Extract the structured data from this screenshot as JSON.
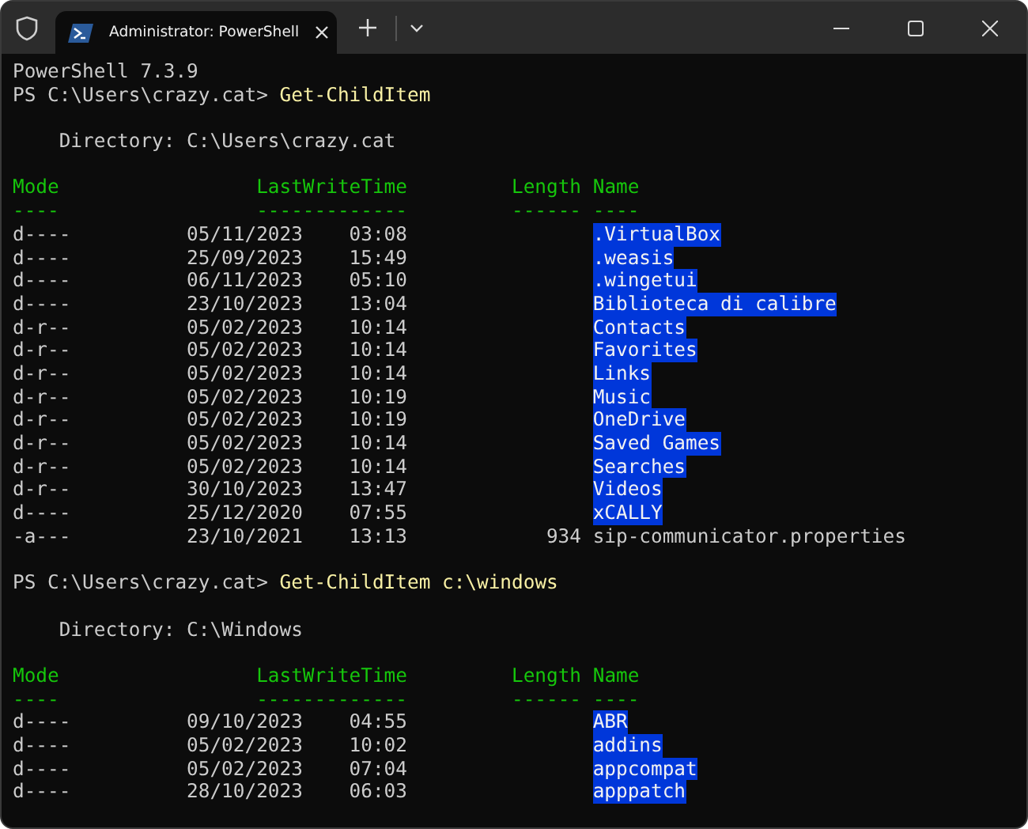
{
  "window": {
    "tab": {
      "title": "Administrator: PowerShell",
      "selected": true
    }
  },
  "console": {
    "banner": "PowerShell 7.3.9",
    "sessions": [
      {
        "prompt": "PS C:\\Users\\crazy.cat>",
        "command": "Get-ChildItem",
        "directory": "Directory: C:\\Users\\crazy.cat",
        "columns": [
          {
            "label": "Mode",
            "rule": "----"
          },
          {
            "label": "LastWriteTime",
            "rule": "-------------"
          },
          {
            "label": "Length",
            "rule": "------"
          },
          {
            "label": "Name",
            "rule": "----"
          }
        ],
        "rows": [
          {
            "mode": "d----",
            "date": "05/11/2023",
            "time": "03:08",
            "length": "",
            "name": ".VirtualBox",
            "kind": "directory"
          },
          {
            "mode": "d----",
            "date": "25/09/2023",
            "time": "15:49",
            "length": "",
            "name": ".weasis",
            "kind": "directory"
          },
          {
            "mode": "d----",
            "date": "06/11/2023",
            "time": "05:10",
            "length": "",
            "name": ".wingetui",
            "kind": "directory"
          },
          {
            "mode": "d----",
            "date": "23/10/2023",
            "time": "13:04",
            "length": "",
            "name": "Biblioteca di calibre",
            "kind": "directory"
          },
          {
            "mode": "d-r--",
            "date": "05/02/2023",
            "time": "10:14",
            "length": "",
            "name": "Contacts",
            "kind": "directory"
          },
          {
            "mode": "d-r--",
            "date": "05/02/2023",
            "time": "10:14",
            "length": "",
            "name": "Favorites",
            "kind": "directory"
          },
          {
            "mode": "d-r--",
            "date": "05/02/2023",
            "time": "10:14",
            "length": "",
            "name": "Links",
            "kind": "directory"
          },
          {
            "mode": "d-r--",
            "date": "05/02/2023",
            "time": "10:19",
            "length": "",
            "name": "Music",
            "kind": "directory"
          },
          {
            "mode": "d-r--",
            "date": "05/02/2023",
            "time": "10:19",
            "length": "",
            "name": "OneDrive",
            "kind": "directory"
          },
          {
            "mode": "d-r--",
            "date": "05/02/2023",
            "time": "10:14",
            "length": "",
            "name": "Saved Games",
            "kind": "directory"
          },
          {
            "mode": "d-r--",
            "date": "05/02/2023",
            "time": "10:14",
            "length": "",
            "name": "Searches",
            "kind": "directory"
          },
          {
            "mode": "d-r--",
            "date": "30/10/2023",
            "time": "13:47",
            "length": "",
            "name": "Videos",
            "kind": "directory"
          },
          {
            "mode": "d----",
            "date": "25/12/2020",
            "time": "07:55",
            "length": "",
            "name": "xCALLY",
            "kind": "directory"
          },
          {
            "mode": "-a---",
            "date": "23/10/2021",
            "time": "13:13",
            "length": "934",
            "name": "sip-communicator.properties",
            "kind": "file"
          }
        ]
      },
      {
        "prompt": "PS C:\\Users\\crazy.cat>",
        "command": "Get-ChildItem c:\\windows",
        "directory": "Directory: C:\\Windows",
        "columns": [
          {
            "label": "Mode",
            "rule": "----"
          },
          {
            "label": "LastWriteTime",
            "rule": "-------------"
          },
          {
            "label": "Length",
            "rule": "------"
          },
          {
            "label": "Name",
            "rule": "----"
          }
        ],
        "rows": [
          {
            "mode": "d----",
            "date": "09/10/2023",
            "time": "04:55",
            "length": "",
            "name": "ABR",
            "kind": "directory"
          },
          {
            "mode": "d----",
            "date": "05/02/2023",
            "time": "10:02",
            "length": "",
            "name": "addins",
            "kind": "directory"
          },
          {
            "mode": "d----",
            "date": "05/02/2023",
            "time": "07:04",
            "length": "",
            "name": "appcompat",
            "kind": "directory"
          },
          {
            "mode": "d----",
            "date": "28/10/2023",
            "time": "06:03",
            "length": "",
            "name": "apppatch",
            "kind": "directory"
          }
        ]
      }
    ]
  }
}
